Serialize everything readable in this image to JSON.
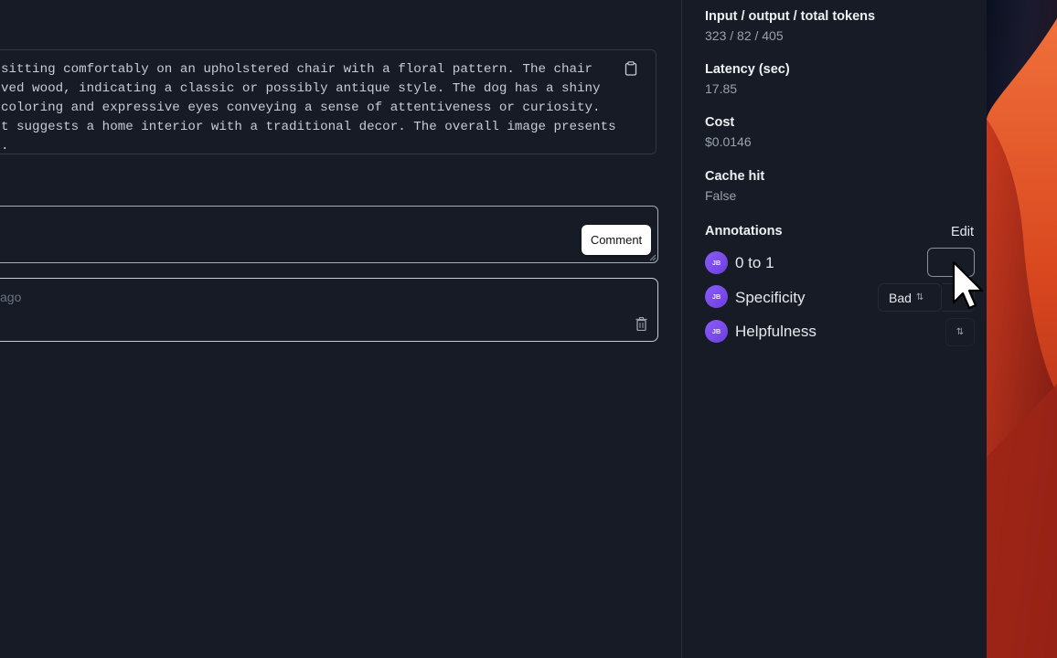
{
  "output": {
    "lines": [
      "sitting comfortably on an upholstered chair with a floral pattern. The chair",
      "ved wood, indicating a classic or possibly antique style. The dog has a shiny",
      "coloring and expressive eyes conveying a sense of attentiveness or curiosity.",
      "t suggests a home interior with a traditional decor. The overall image presents",
      "."
    ],
    "copy_icon": "clipboard-icon"
  },
  "comment": {
    "button_label": "Comment",
    "input_value": "",
    "item_time": "ago",
    "delete_icon": "trash-icon"
  },
  "sidebar": {
    "tokens": {
      "label": "Input / output / total tokens",
      "value": "323 / 82 / 405"
    },
    "latency": {
      "label": "Latency (sec)",
      "value": "17.85"
    },
    "cost": {
      "label": "Cost",
      "value": "$0.0146"
    },
    "cache": {
      "label": "Cache hit",
      "value": "False"
    },
    "annotations": {
      "title": "Annotations",
      "edit_label": "Edit",
      "items": [
        {
          "avatar": "JB",
          "name": "0 to 1",
          "value": ""
        },
        {
          "avatar": "JB",
          "name": "Specificity",
          "value": "Bad"
        },
        {
          "avatar": "JB",
          "name": "Helpfulness",
          "value": ""
        }
      ]
    }
  },
  "colors": {
    "background": "#161b26",
    "avatar": "#7c4dea",
    "wallpaper_accent": "#e4552a"
  }
}
